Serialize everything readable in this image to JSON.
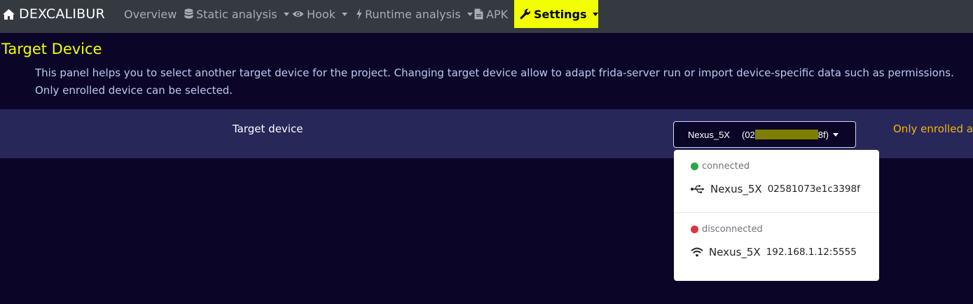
{
  "navbar": {
    "brand": "DEXCALIBUR",
    "items": [
      {
        "label": "Overview"
      },
      {
        "label": "Static analysis"
      },
      {
        "label": "Hook"
      },
      {
        "label": "Runtime analysis"
      },
      {
        "label": "APK"
      },
      {
        "label": "Settings",
        "active": true
      }
    ]
  },
  "page": {
    "title": "Target Device",
    "description": "This panel helps you to select another target device for the project. Changing target device allow to adapt frida-server run or import device-specific data such as permissions. Only enrolled device can be selected."
  },
  "setting": {
    "label": "Target device",
    "selected_name": "Nexus_5X",
    "selected_id_prefix": "(02",
    "selected_id_suffix": "8f)",
    "help_text": "Only enrolled an"
  },
  "dropdown": {
    "groups": [
      {
        "status": "connected",
        "status_color": "#28a745",
        "icon": "usb-icon",
        "name": "Nexus_5X",
        "id": "02581073e1c3398f"
      },
      {
        "status": "disconnected",
        "status_color": "#dc3545",
        "icon": "wifi-icon",
        "name": "Nexus_5X",
        "id": "192.168.1.12:5555"
      }
    ]
  },
  "colors": {
    "accent": "#f2ff00",
    "navbar_bg": "#343a40",
    "page_bg": "#0b0627",
    "row_bg": "#27275a",
    "help_text": "#f7b500"
  }
}
